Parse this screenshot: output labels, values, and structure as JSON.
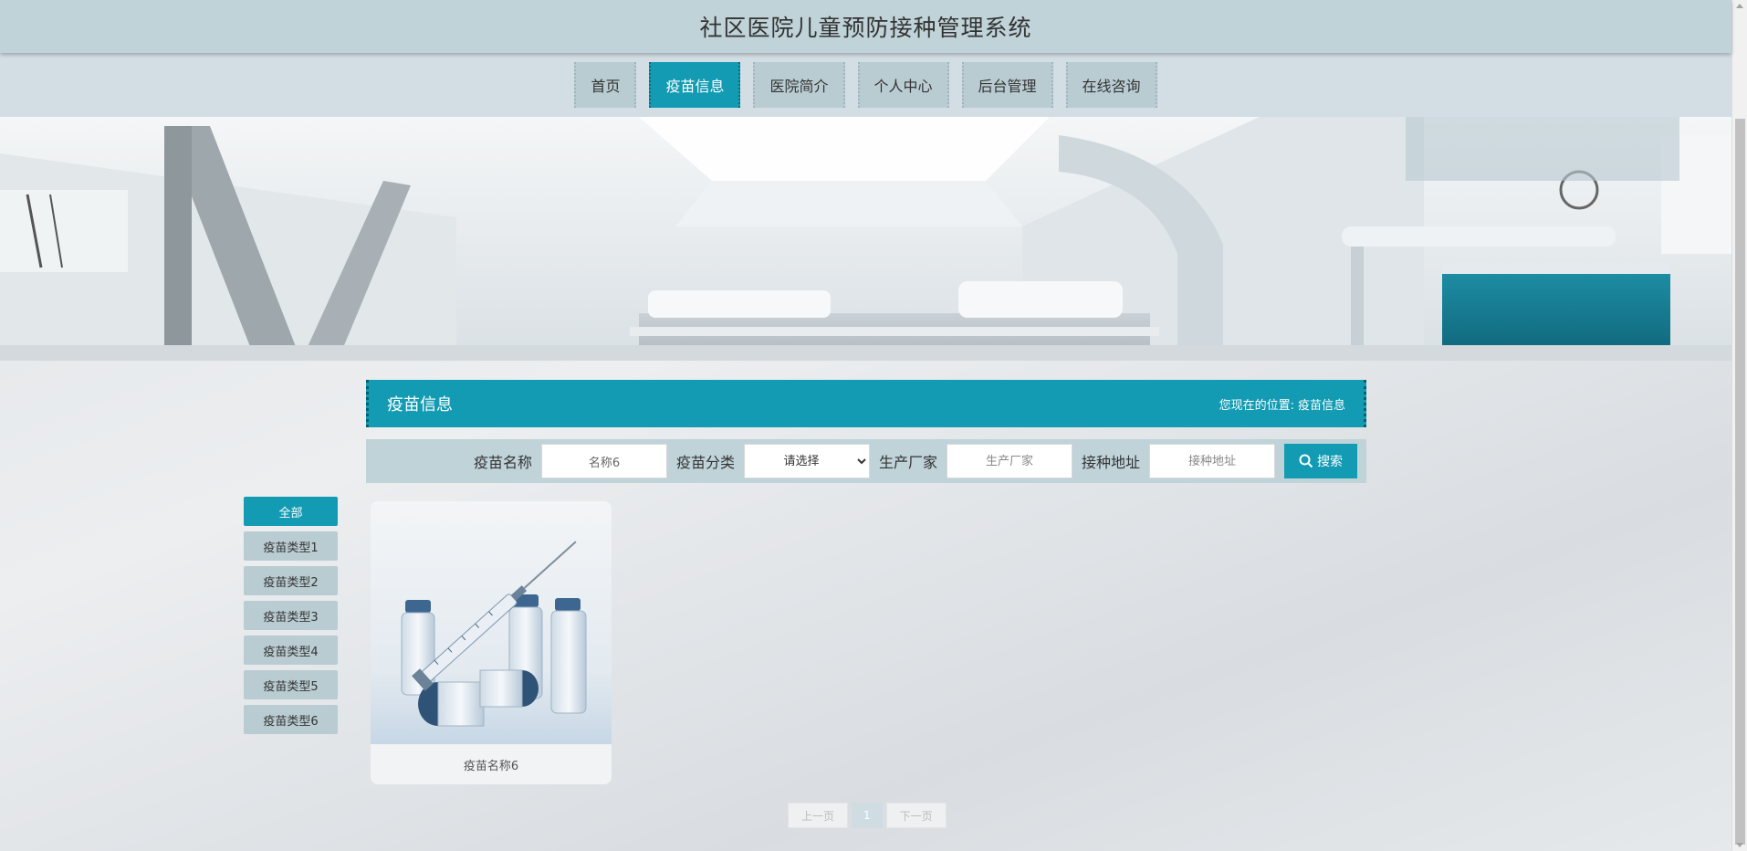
{
  "header": {
    "title": "社区医院儿童预防接种管理系统"
  },
  "nav": {
    "items": [
      {
        "label": "首页",
        "active": false
      },
      {
        "label": "疫苗信息",
        "active": true
      },
      {
        "label": "医院简介",
        "active": false
      },
      {
        "label": "个人中心",
        "active": false
      },
      {
        "label": "后台管理",
        "active": false
      },
      {
        "label": "在线咨询",
        "active": false
      }
    ]
  },
  "section": {
    "title": "疫苗信息",
    "breadcrumb_prefix": "您现在的位置:",
    "breadcrumb_current": "疫苗信息"
  },
  "search": {
    "name_label": "疫苗名称",
    "name_value": "名称6",
    "category_label": "疫苗分类",
    "category_selected": "请选择",
    "manufacturer_label": "生产厂家",
    "manufacturer_placeholder": "生产厂家",
    "address_label": "接种地址",
    "address_placeholder": "接种地址",
    "button_label": "搜索"
  },
  "categories": [
    {
      "label": "全部",
      "active": true
    },
    {
      "label": "疫苗类型1",
      "active": false
    },
    {
      "label": "疫苗类型2",
      "active": false
    },
    {
      "label": "疫苗类型3",
      "active": false
    },
    {
      "label": "疫苗类型4",
      "active": false
    },
    {
      "label": "疫苗类型5",
      "active": false
    },
    {
      "label": "疫苗类型6",
      "active": false
    }
  ],
  "products": [
    {
      "name": "疫苗名称6",
      "image": "vaccine-vials-syringe-image"
    }
  ],
  "pagination": {
    "prev": "上一页",
    "current": "1",
    "next": "下一页"
  },
  "colors": {
    "accent": "#129bb3",
    "header_bg": "#bfd3d9",
    "nav_bg": "#d2dee4",
    "nav_item_bg": "#b9ccd2"
  }
}
